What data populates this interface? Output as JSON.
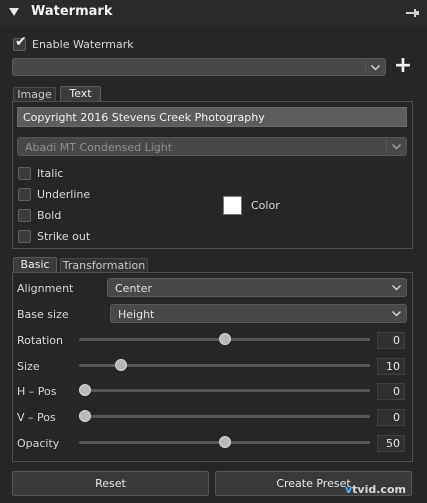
{
  "panel": {
    "title": "Watermark"
  },
  "enable": {
    "label": "Enable Watermark",
    "checked": true
  },
  "preset_dropdown": {
    "value": ""
  },
  "top_tabs": [
    {
      "label": "Image",
      "active": false
    },
    {
      "label": "Text",
      "active": true
    }
  ],
  "text_tab": {
    "text_value": "Copyright 2016 Stevens Creek Photography",
    "font_value": "Abadi MT Condensed Light",
    "styles": [
      {
        "label": "Italic",
        "checked": false
      },
      {
        "label": "Underline",
        "checked": false
      },
      {
        "label": "Bold",
        "checked": false
      },
      {
        "label": "Strike out",
        "checked": false
      }
    ],
    "color_label": "Color",
    "color_value": "#ffffff"
  },
  "bottom_tabs": [
    {
      "label": "Basic",
      "active": true
    },
    {
      "label": "Transformation",
      "active": false
    }
  ],
  "basic": {
    "alignment": {
      "label": "Alignment",
      "value": "Center"
    },
    "base_size": {
      "label": "Base size",
      "value": "Height"
    },
    "sliders": [
      {
        "label": "Rotation",
        "value": "0",
        "fraction": 0.5
      },
      {
        "label": "Size",
        "value": "10",
        "fraction": 0.13
      },
      {
        "label": "H – Pos",
        "value": "0",
        "fraction": 0.0
      },
      {
        "label": "V – Pos",
        "value": "0",
        "fraction": 0.0
      },
      {
        "label": "Opacity",
        "value": "50",
        "fraction": 0.5
      }
    ]
  },
  "buttons": {
    "reset": "Reset",
    "create_preset": "Create Preset"
  },
  "logo": {
    "prefix": "v",
    "rest": "tvid.com"
  }
}
